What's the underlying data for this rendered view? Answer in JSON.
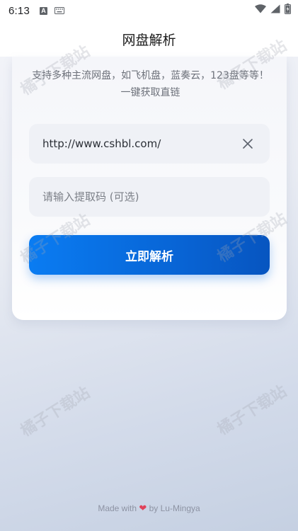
{
  "status_bar": {
    "time": "6:13",
    "badge_letter": "A"
  },
  "header": {
    "title": "网盘解析"
  },
  "main": {
    "description": "支持多种主流网盘，如飞机盘，蓝奏云，123盘等等！一键获取直链",
    "url_field": {
      "value": "http://www.cshbl.com/",
      "placeholder": ""
    },
    "code_field": {
      "value": "",
      "placeholder": "请输入提取码 (可选)"
    },
    "parse_button": {
      "label": "立即解析"
    }
  },
  "footer": {
    "prefix": "Made with",
    "heart": "❤",
    "suffix": "by Lu-Mingya"
  },
  "watermark": {
    "text": "橘子下载站"
  },
  "colors": {
    "accent": "#0a7cf2",
    "heart": "#e0425a",
    "background": "#e9ecf3"
  },
  "icons": [
    "a-icon",
    "keyboard-icon",
    "wifi-icon",
    "signal-icon",
    "battery-icon",
    "clear-icon",
    "heart-icon"
  ]
}
